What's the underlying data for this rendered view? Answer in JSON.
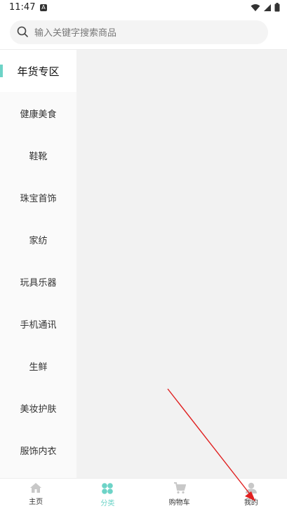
{
  "status_bar": {
    "time": "11:47",
    "notif_letter": "A"
  },
  "search": {
    "placeholder": "输入关键字搜索商品"
  },
  "sidebar": {
    "items": [
      {
        "label": "年货专区"
      },
      {
        "label": "健康美食"
      },
      {
        "label": "鞋靴"
      },
      {
        "label": "珠宝首饰"
      },
      {
        "label": "家纺"
      },
      {
        "label": "玩具乐器"
      },
      {
        "label": "手机通讯"
      },
      {
        "label": "生鲜"
      },
      {
        "label": "美妆护肤"
      },
      {
        "label": "服饰内衣"
      }
    ],
    "active_index": 0
  },
  "tabbar": {
    "items": [
      {
        "label": "主页",
        "icon": "home-icon"
      },
      {
        "label": "分类",
        "icon": "category-icon"
      },
      {
        "label": "购物车",
        "icon": "cart-icon"
      },
      {
        "label": "我的",
        "icon": "profile-icon"
      }
    ],
    "active_index": 1
  },
  "colors": {
    "accent": "#6dd3c7",
    "arrow": "#e02020"
  }
}
